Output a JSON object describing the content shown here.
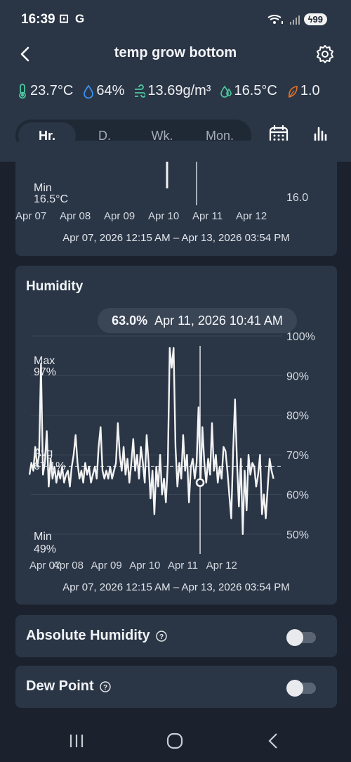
{
  "status": {
    "time": "16:39",
    "left_icons": "⊡ G",
    "battery": "99",
    "signal_icons": [
      "wifi-icon",
      "signal-icon"
    ]
  },
  "header": {
    "title": "temp grow bottom"
  },
  "readings": [
    {
      "icon": "thermometer-icon",
      "value": "23.7°C",
      "color": "#4cc9a0"
    },
    {
      "icon": "droplet-icon",
      "value": "64%",
      "color": "#3a8ff5"
    },
    {
      "icon": "wind-icon",
      "value": "13.69g/m³",
      "color": "#4cc9a0"
    },
    {
      "icon": "dew-icon",
      "value": "16.5°C",
      "color": "#4cc9a0"
    },
    {
      "icon": "leaf-icon",
      "value": "1.0",
      "color": "#e2742a"
    }
  ],
  "tabs": [
    "Hr.",
    "D.",
    "Wk.",
    "Mon."
  ],
  "active_tab": 0,
  "temp_card": {
    "min_label": "Min",
    "min_value": "16.5°C",
    "y_ticks": [
      "16.0"
    ],
    "x_labels": [
      "Apr 07",
      "Apr 08",
      "Apr 09",
      "Apr 10",
      "Apr 11",
      "Apr 12"
    ],
    "range": "Apr 07, 2026 12:15 AM – Apr 13, 2026 03:54 PM"
  },
  "humidity_card": {
    "title": "Humidity",
    "tooltip_value": "63.0%",
    "tooltip_time": "Apr 11, 2026 10:41 AM",
    "max_label": "Max",
    "max_value": "97%",
    "avg_label": "Avg",
    "avg_value": "67.1%",
    "min_label": "Min",
    "min_value": "49%",
    "range": "Apr 07, 2026 12:15 AM – Apr 13, 2026 03:54 PM"
  },
  "chart_data": {
    "type": "line",
    "title": "Humidity",
    "xlabel": "",
    "ylabel": "",
    "ylim": [
      45,
      100
    ],
    "y_ticks": [
      50,
      60,
      70,
      80,
      90,
      100
    ],
    "y_tick_labels": [
      "50%",
      "60%",
      "70%",
      "80%",
      "90%",
      "100%"
    ],
    "x_tick_labels": [
      "Apr 07",
      "Apr 08",
      "Apr 09",
      "Apr 10",
      "Apr 11",
      "Apr 12"
    ],
    "x_range_days": [
      0,
      6.65
    ],
    "grid": true,
    "average": 67.1,
    "selected": {
      "x": 4.44,
      "y": 63.0
    },
    "series": [
      {
        "values": [
          [
            0.0,
            65
          ],
          [
            0.05,
            68
          ],
          [
            0.1,
            66
          ],
          [
            0.15,
            72
          ],
          [
            0.2,
            67
          ],
          [
            0.25,
            70
          ],
          [
            0.3,
            93
          ],
          [
            0.35,
            65
          ],
          [
            0.4,
            68
          ],
          [
            0.45,
            76
          ],
          [
            0.5,
            62
          ],
          [
            0.55,
            69
          ],
          [
            0.6,
            64
          ],
          [
            0.65,
            67
          ],
          [
            0.7,
            63
          ],
          [
            0.75,
            66
          ],
          [
            0.8,
            64
          ],
          [
            0.85,
            67
          ],
          [
            0.9,
            63
          ],
          [
            0.95,
            65
          ],
          [
            1.0,
            66
          ],
          [
            1.05,
            62
          ],
          [
            1.1,
            67
          ],
          [
            1.15,
            70
          ],
          [
            1.2,
            75
          ],
          [
            1.25,
            68
          ],
          [
            1.3,
            64
          ],
          [
            1.35,
            66
          ],
          [
            1.4,
            63
          ],
          [
            1.45,
            68
          ],
          [
            1.5,
            65
          ],
          [
            1.55,
            67
          ],
          [
            1.6,
            63
          ],
          [
            1.65,
            65
          ],
          [
            1.7,
            67
          ],
          [
            1.75,
            64
          ],
          [
            1.8,
            72
          ],
          [
            1.85,
            77
          ],
          [
            1.9,
            66
          ],
          [
            1.95,
            64
          ],
          [
            2.0,
            66
          ],
          [
            2.05,
            64
          ],
          [
            2.1,
            67
          ],
          [
            2.15,
            64
          ],
          [
            2.2,
            66
          ],
          [
            2.25,
            68
          ],
          [
            2.3,
            78
          ],
          [
            2.35,
            70
          ],
          [
            2.4,
            66
          ],
          [
            2.45,
            72
          ],
          [
            2.5,
            65
          ],
          [
            2.55,
            69
          ],
          [
            2.6,
            63
          ],
          [
            2.65,
            68
          ],
          [
            2.7,
            74
          ],
          [
            2.75,
            66
          ],
          [
            2.8,
            70
          ],
          [
            2.85,
            64
          ],
          [
            2.9,
            72
          ],
          [
            2.95,
            68
          ],
          [
            3.0,
            63
          ],
          [
            3.05,
            75
          ],
          [
            3.1,
            68
          ],
          [
            3.15,
            59
          ],
          [
            3.2,
            66
          ],
          [
            3.25,
            55
          ],
          [
            3.3,
            67
          ],
          [
            3.35,
            62
          ],
          [
            3.4,
            70
          ],
          [
            3.45,
            60
          ],
          [
            3.5,
            64
          ],
          [
            3.55,
            58
          ],
          [
            3.6,
            68
          ],
          [
            3.65,
            97
          ],
          [
            3.7,
            92
          ],
          [
            3.75,
            97
          ],
          [
            3.8,
            72
          ],
          [
            3.85,
            62
          ],
          [
            3.9,
            68
          ],
          [
            3.95,
            64
          ],
          [
            4.0,
            75
          ],
          [
            4.05,
            66
          ],
          [
            4.1,
            70
          ],
          [
            4.15,
            58
          ],
          [
            4.2,
            67
          ],
          [
            4.25,
            69
          ],
          [
            4.3,
            64
          ],
          [
            4.35,
            68
          ],
          [
            4.4,
            82
          ],
          [
            4.45,
            63
          ],
          [
            4.5,
            77
          ],
          [
            4.55,
            68
          ],
          [
            4.6,
            63
          ],
          [
            4.65,
            69
          ],
          [
            4.7,
            65
          ],
          [
            4.75,
            78
          ],
          [
            4.8,
            66
          ],
          [
            4.85,
            70
          ],
          [
            4.9,
            63
          ],
          [
            4.95,
            67
          ],
          [
            5.0,
            64
          ],
          [
            5.05,
            72
          ],
          [
            5.1,
            71
          ],
          [
            5.15,
            66
          ],
          [
            5.2,
            60
          ],
          [
            5.25,
            54
          ],
          [
            5.3,
            71
          ],
          [
            5.35,
            84
          ],
          [
            5.4,
            68
          ],
          [
            5.45,
            57
          ],
          [
            5.5,
            69
          ],
          [
            5.55,
            50
          ],
          [
            5.6,
            66
          ],
          [
            5.65,
            56
          ],
          [
            5.7,
            70
          ],
          [
            5.75,
            65
          ],
          [
            5.8,
            68
          ],
          [
            5.85,
            67
          ],
          [
            5.9,
            62
          ],
          [
            5.95,
            65
          ],
          [
            6.0,
            70
          ],
          [
            6.05,
            55
          ],
          [
            6.1,
            60
          ],
          [
            6.15,
            54
          ],
          [
            6.2,
            62
          ],
          [
            6.25,
            69
          ],
          [
            6.3,
            66
          ],
          [
            6.35,
            64
          ]
        ]
      }
    ]
  },
  "toggles": [
    {
      "label": "Absolute Humidity",
      "on": false
    },
    {
      "label": "Dew Point",
      "on": false
    }
  ]
}
